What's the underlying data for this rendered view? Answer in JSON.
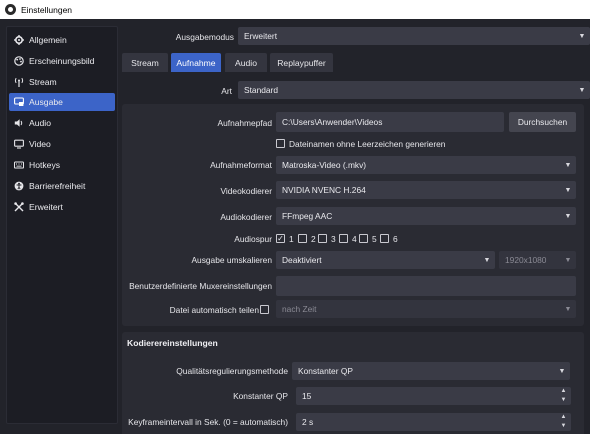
{
  "window": {
    "title": "Einstellungen"
  },
  "sidebar": {
    "items": [
      {
        "label": "Allgemein",
        "icon": "gear-icon"
      },
      {
        "label": "Erscheinungsbild",
        "icon": "palette-icon"
      },
      {
        "label": "Stream",
        "icon": "broadcast-icon"
      },
      {
        "label": "Ausgabe",
        "icon": "output-icon"
      },
      {
        "label": "Audio",
        "icon": "speaker-icon"
      },
      {
        "label": "Video",
        "icon": "monitor-icon"
      },
      {
        "label": "Hotkeys",
        "icon": "keyboard-icon"
      },
      {
        "label": "Barrierefreiheit",
        "icon": "accessibility-icon"
      },
      {
        "label": "Erweitert",
        "icon": "tools-icon"
      }
    ],
    "active_index": 3
  },
  "output_mode": {
    "label": "Ausgabemodus",
    "value": "Erweitert"
  },
  "tabs": [
    {
      "label": "Stream"
    },
    {
      "label": "Aufnahme"
    },
    {
      "label": "Audio"
    },
    {
      "label": "Replaypuffer"
    }
  ],
  "active_tab": "Aufnahme",
  "type_row": {
    "label": "Art",
    "value": "Standard"
  },
  "recording": {
    "path_label": "Aufnahmepfad",
    "path_value": "C:\\Users\\Anwender\\Videos",
    "browse_label": "Durchsuchen",
    "no_spaces_label": "Dateinamen ohne Leerzeichen generieren",
    "no_spaces_checked": false,
    "format_label": "Aufnahmeformat",
    "format_value": "Matroska-Video (.mkv)",
    "video_encoder_label": "Videokodierer",
    "video_encoder_value": "NVIDIA NVENC H.264",
    "audio_encoder_label": "Audiokodierer",
    "audio_encoder_value": "FFmpeg AAC",
    "audio_track_label": "Audiospur",
    "audio_tracks": [
      {
        "label": "1",
        "checked": true
      },
      {
        "label": "2",
        "checked": false
      },
      {
        "label": "3",
        "checked": false
      },
      {
        "label": "4",
        "checked": false
      },
      {
        "label": "5",
        "checked": false
      },
      {
        "label": "6",
        "checked": false
      }
    ],
    "rescale_label": "Ausgabe umskalieren",
    "rescale_value": "Deaktiviert",
    "rescale_resolution": "1920x1080",
    "muxer_label": "Benutzerdefinierte Muxereinstellungen",
    "muxer_value": "",
    "autosplit_label": "Datei automatisch teilen",
    "autosplit_checked": false,
    "autosplit_value": "nach Zeit"
  },
  "encoder_settings": {
    "section_title": "Kodierereinstellungen",
    "rate_control_label": "Qualitätsregulierungsmethode",
    "rate_control_value": "Konstanter QP",
    "cqp_label": "Konstanter QP",
    "cqp_value": "15",
    "keyframe_label": "Keyframeintervall in Sek. (0 = automatisch)",
    "keyframe_value": "2 s"
  },
  "colors": {
    "accent": "#3c64c8",
    "background": "#22232a",
    "panel": "#2a2b33",
    "field": "#3a3b46"
  }
}
